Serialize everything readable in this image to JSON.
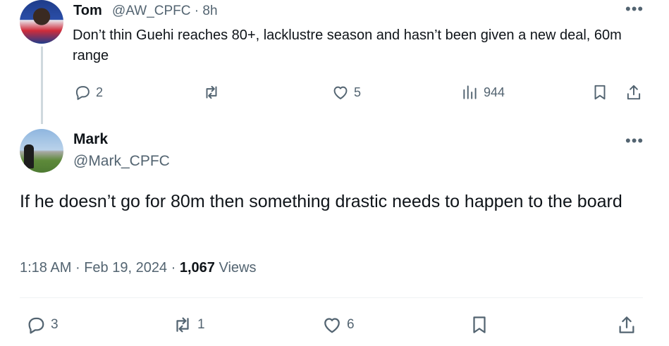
{
  "parent_tweet": {
    "name": "Tom",
    "handle": "@AW_CPFC",
    "separator": "·",
    "time": "8h",
    "text": "Don’t thin Guehi reaches 80+, lacklustre season and hasn’t been given a new deal, 60m range",
    "more_label": "•••",
    "replies": "2",
    "likes": "5",
    "views": "944"
  },
  "main_tweet": {
    "name": "Mark",
    "handle": "@Mark_CPFC",
    "more_label": "•••",
    "text": "If he doesn’t go for 80m then something drastic needs to happen to the board",
    "time": "1:18 AM",
    "dot": "·",
    "date": "Feb 19, 2024",
    "views_count": "1,067",
    "views_label": "Views",
    "replies": "3",
    "reposts": "1",
    "likes": "6"
  },
  "icons": {
    "reply": "reply-icon",
    "repost": "repost-icon",
    "like": "heart-icon",
    "views": "views-chart-icon",
    "bookmark": "bookmark-icon",
    "share": "share-icon",
    "more": "more-dots-icon"
  },
  "colors": {
    "text_primary": "#0f1419",
    "text_secondary": "#536471",
    "thread_line": "#cfd9de",
    "divider": "#eff3f4"
  }
}
